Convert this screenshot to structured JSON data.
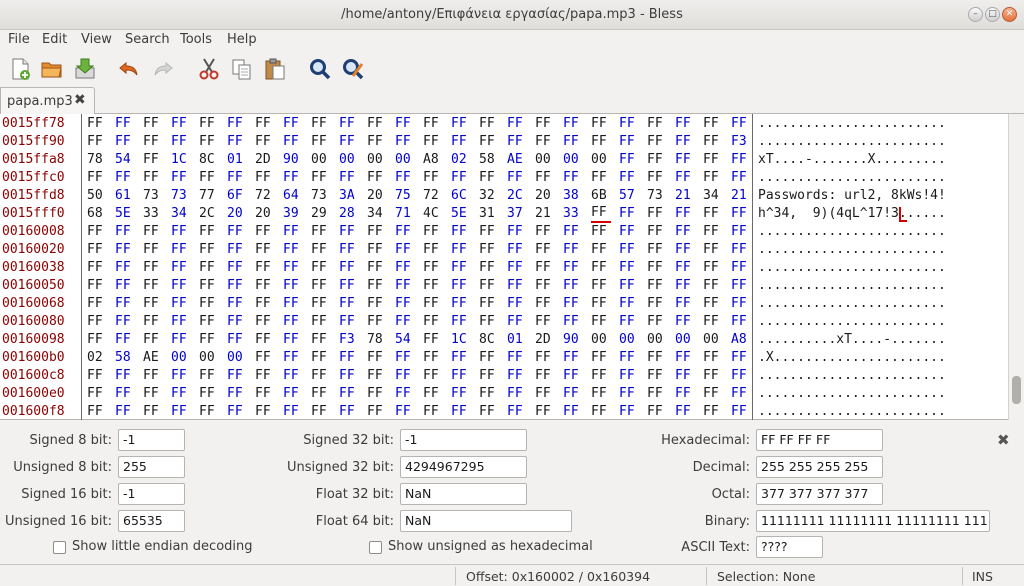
{
  "window": {
    "title": "/home/antony/Επιφάνεια εργασίας/papa.mp3 - Bless"
  },
  "menu": [
    "File",
    "Edit",
    "View",
    "Search",
    "Tools",
    "Help"
  ],
  "toolbar": [
    {
      "name": "new-file-icon"
    },
    {
      "name": "open-file-icon"
    },
    {
      "name": "save-file-icon"
    },
    {
      "name": "undo-icon"
    },
    {
      "name": "redo-icon"
    },
    {
      "name": "cut-icon"
    },
    {
      "name": "copy-icon"
    },
    {
      "name": "paste-icon"
    },
    {
      "name": "find-icon"
    },
    {
      "name": "find-replace-icon"
    }
  ],
  "tab": {
    "label": "papa.mp3"
  },
  "hex_view": {
    "rows": [
      {
        "offset": "0015ff78",
        "bytes": "FF FF FF FF FF FF FF FF FF FF FF FF FF FF FF FF FF FF FF FF FF FF FF FF",
        "ascii": "........................"
      },
      {
        "offset": "0015ff90",
        "bytes": "FF FF FF FF FF FF FF FF FF FF FF FF FF FF FF FF FF FF FF FF FF FF FF F3",
        "ascii": "........................"
      },
      {
        "offset": "0015ffa8",
        "bytes": "78 54 FF 1C 8C 01 2D 90 00 00 00 00 A8 02 58 AE 00 00 00 FF FF FF FF FF",
        "ascii": "xT....-.......X........."
      },
      {
        "offset": "0015ffc0",
        "bytes": "FF FF FF FF FF FF FF FF FF FF FF FF FF FF FF FF FF FF FF FF FF FF FF FF",
        "ascii": "........................"
      },
      {
        "offset": "0015ffd8",
        "bytes": "50 61 73 73 77 6F 72 64 73 3A 20 75 72 6C 32 2C 20 38 6B 57 73 21 34 21",
        "ascii": "Passwords: url2, 8kWs!4!"
      },
      {
        "offset": "0015fff0",
        "bytes": "68 5E 33 34 2C 20 20 39 29 28 34 71 4C 5E 31 37 21 33 FF FF FF FF FF FF",
        "ascii": "h^34,  9)(4qL^17!3......"
      },
      {
        "offset": "00160008",
        "bytes": "FF FF FF FF FF FF FF FF FF FF FF FF FF FF FF FF FF FF FF FF FF FF FF FF",
        "ascii": "........................"
      },
      {
        "offset": "00160020",
        "bytes": "FF FF FF FF FF FF FF FF FF FF FF FF FF FF FF FF FF FF FF FF FF FF FF FF",
        "ascii": "........................"
      },
      {
        "offset": "00160038",
        "bytes": "FF FF FF FF FF FF FF FF FF FF FF FF FF FF FF FF FF FF FF FF FF FF FF FF",
        "ascii": "........................"
      },
      {
        "offset": "00160050",
        "bytes": "FF FF FF FF FF FF FF FF FF FF FF FF FF FF FF FF FF FF FF FF FF FF FF FF",
        "ascii": "........................"
      },
      {
        "offset": "00160068",
        "bytes": "FF FF FF FF FF FF FF FF FF FF FF FF FF FF FF FF FF FF FF FF FF FF FF FF",
        "ascii": "........................"
      },
      {
        "offset": "00160080",
        "bytes": "FF FF FF FF FF FF FF FF FF FF FF FF FF FF FF FF FF FF FF FF FF FF FF FF",
        "ascii": "........................"
      },
      {
        "offset": "00160098",
        "bytes": "FF FF FF FF FF FF FF FF FF F3 78 54 FF 1C 8C 01 2D 90 00 00 00 00 00 A8",
        "ascii": "..........xT....-......."
      },
      {
        "offset": "001600b0",
        "bytes": "02 58 AE 00 00 00 FF FF FF FF FF FF FF FF FF FF FF FF FF FF FF FF FF FF",
        "ascii": ".X......................"
      },
      {
        "offset": "001600c8",
        "bytes": "FF FF FF FF FF FF FF FF FF FF FF FF FF FF FF FF FF FF FF FF FF FF FF FF",
        "ascii": "........................"
      },
      {
        "offset": "001600e0",
        "bytes": "FF FF FF FF FF FF FF FF FF FF FF FF FF FF FF FF FF FF FF FF FF FF FF FF",
        "ascii": "........................"
      },
      {
        "offset": "001600f8",
        "bytes": "FF FF FF FF FF FF FF FF FF FF FF FF FF FF FF FF FF FF FF FF FF FF FF FF",
        "ascii": "........................"
      }
    ]
  },
  "converter": {
    "signed8_label": "Signed 8 bit:",
    "signed8": "-1",
    "unsigned8_label": "Unsigned 8 bit:",
    "unsigned8": "255",
    "signed16_label": "Signed 16 bit:",
    "signed16": "-1",
    "unsigned16_label": "Unsigned 16 bit:",
    "unsigned16": "65535",
    "signed32_label": "Signed 32 bit:",
    "signed32": "-1",
    "unsigned32_label": "Unsigned 32 bit:",
    "unsigned32": "4294967295",
    "float32_label": "Float 32 bit:",
    "float32": "NaN",
    "float64_label": "Float 64 bit:",
    "float64": "NaN",
    "hex_label": "Hexadecimal:",
    "hex": "FF FF FF FF",
    "dec_label": "Decimal:",
    "dec": "255 255 255 255",
    "oct_label": "Octal:",
    "oct": "377 377 377 377",
    "bin_label": "Binary:",
    "bin": "11111111 11111111 11111111 11111111",
    "ascii_label": "ASCII Text:",
    "ascii": "????",
    "little_endian_label": "Show little endian decoding",
    "unsigned_hex_label": "Show unsigned as hexadecimal"
  },
  "status": {
    "offset": "Offset: 0x160002 / 0x160394",
    "selection": "Selection: None",
    "mode": "INS"
  }
}
